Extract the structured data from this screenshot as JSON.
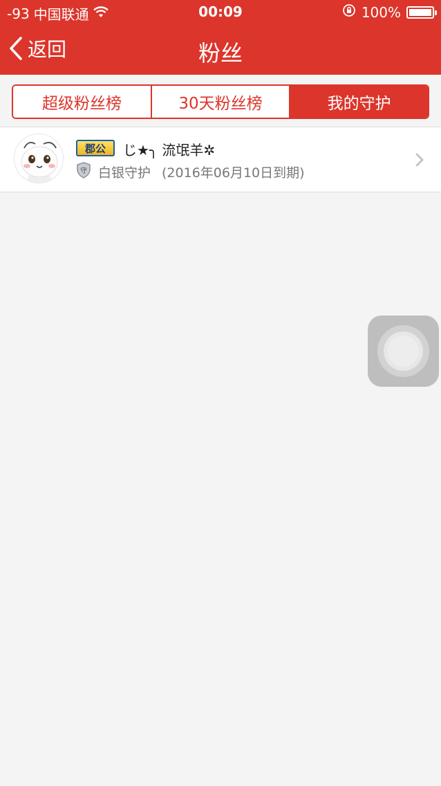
{
  "status_bar": {
    "signal": "-93",
    "carrier": "中国联通",
    "time": "00:09",
    "battery": "100%"
  },
  "nav": {
    "back_label": "返回",
    "title": "粉丝"
  },
  "tabs": [
    {
      "label": "超级粉丝榜",
      "active": false
    },
    {
      "label": "30天粉丝榜",
      "active": false
    },
    {
      "label": "我的守护",
      "active": true
    }
  ],
  "guard_list": [
    {
      "badge": "郡公",
      "name": "じ★╮ 流氓羊✲",
      "guard_level": "白银守护",
      "expiry": "(2016年06月10日到期)"
    }
  ],
  "colors": {
    "brand": "#dc352b",
    "background": "#f4f4f4"
  }
}
